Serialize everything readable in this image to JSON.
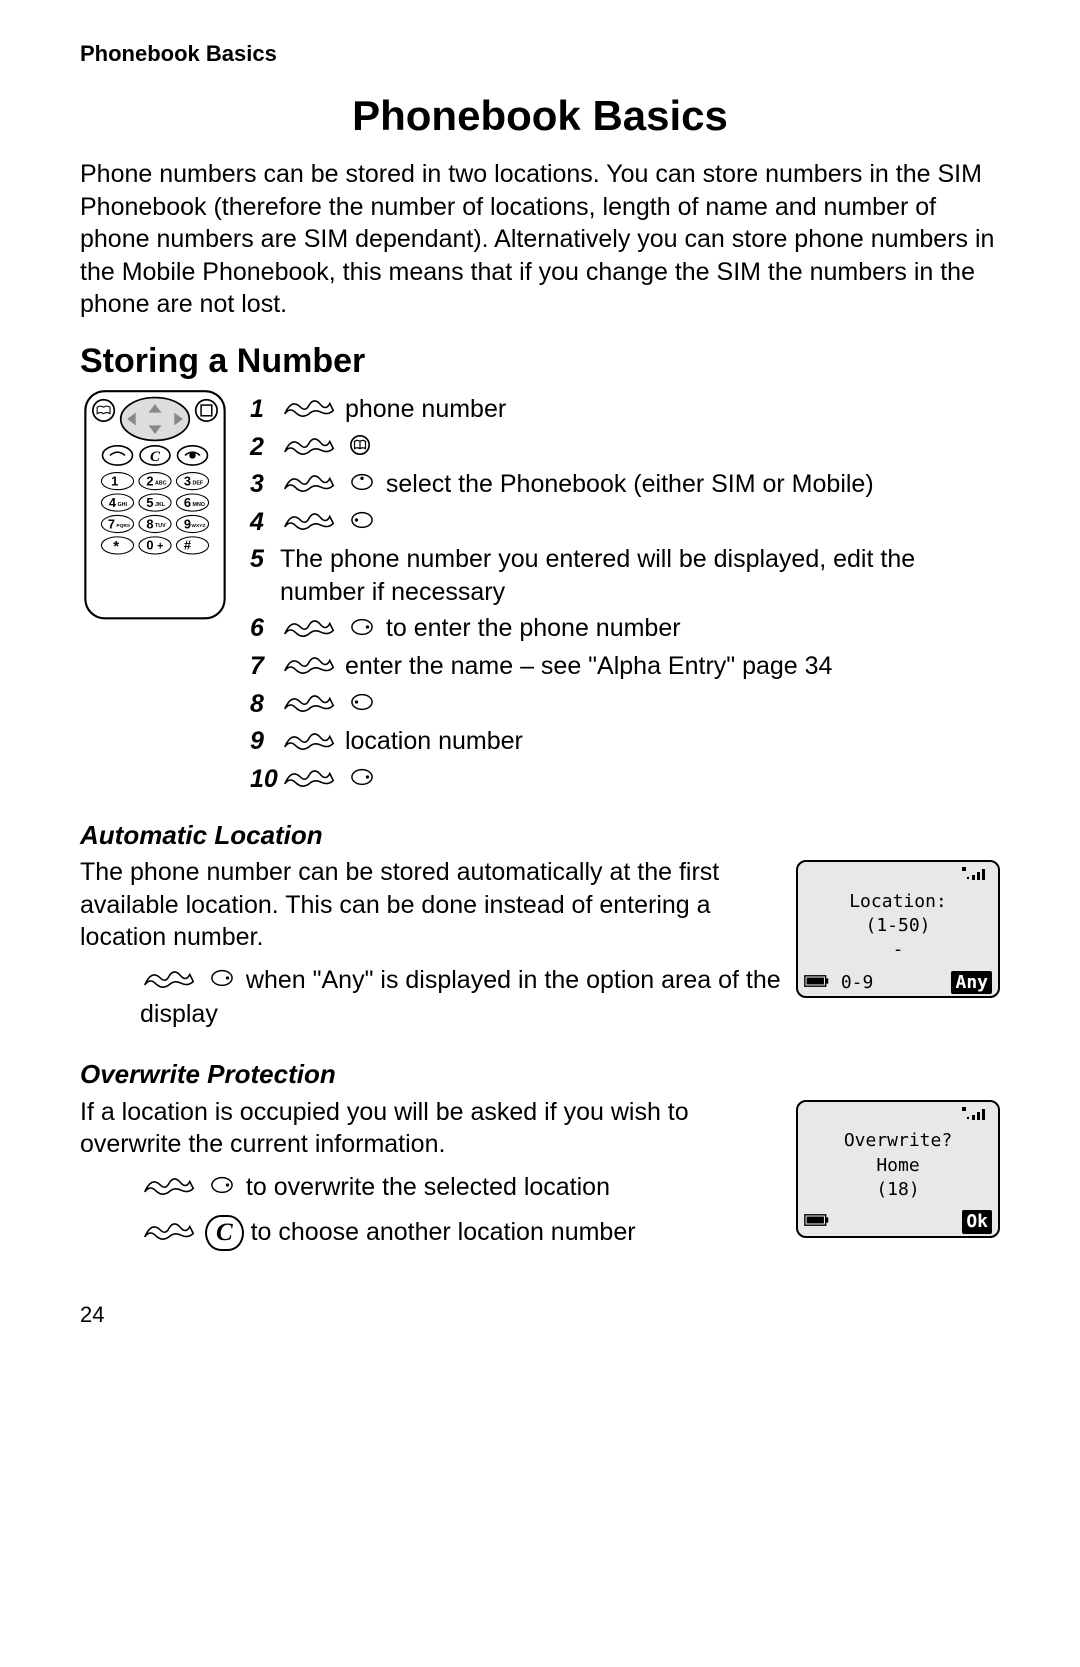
{
  "header": "Phonebook Basics",
  "title": "Phonebook Basics",
  "intro": "Phone numbers can be stored in two locations. You can store numbers in the SIM Phonebook (therefore the number of locations, length of name and number of phone numbers are SIM dependant). Alternatively you can store phone numbers in the Mobile Phonebook, this means that if you change the SIM the numbers in the phone are not lost.",
  "h2": "Storing a Number",
  "steps": {
    "s1": "phone number",
    "s3": "select the Phonebook (either SIM or Mobile)",
    "s5": "The phone number you entered will be displayed, edit the number if necessary",
    "s6": "to enter the phone number",
    "s7": "enter the name – see \"Alpha Entry\" page 34",
    "s9": "location number"
  },
  "auto": {
    "title": "Automatic Location",
    "para": "The phone number can be stored automatically at the first available location. This can be done instead of entering a location number.",
    "action": "when \"Any\" is displayed in the option area of the display"
  },
  "over": {
    "title": "Overwrite Protection",
    "para": "If a location is occupied you will be asked if you wish to overwrite the current information.",
    "a1": "to overwrite the selected location",
    "a2": "to choose another location number"
  },
  "screen1": {
    "signal": "▝▗▖▌▌",
    "line1": "Location:",
    "line2": "(1-50)",
    "line3": "-",
    "left": "0-9",
    "right": "Any"
  },
  "screen2": {
    "signal": "▝▗▖▌▌",
    "line1": "Overwrite?",
    "line2": "Home",
    "line3": "(18)",
    "right": "Ok"
  },
  "pagenum": "24",
  "phone_keys": [
    [
      "1",
      "2 ABC",
      "3 DEF"
    ],
    [
      "4 GHI",
      "5 JKL",
      "6 MNO"
    ],
    [
      "7 PQRS",
      "8 TUV",
      "9 WXYZ"
    ],
    [
      "*",
      "0 +",
      "#"
    ]
  ]
}
